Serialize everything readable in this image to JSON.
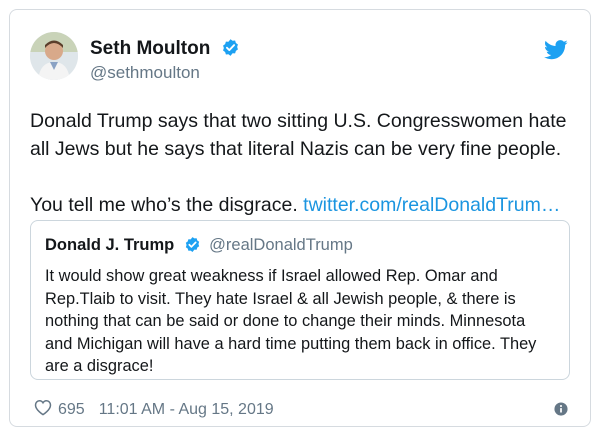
{
  "author": {
    "name": "Seth Moulton",
    "handle": "@sethmoulton"
  },
  "tweet": {
    "lines": [
      "Donald Trump says that two sitting U.S. Congresswomen hate",
      "all Jews but he says that literal Nazis can be very fine people."
    ],
    "closing": "You tell me who’s the disgrace.",
    "link": "twitter.com/realDonaldTrum…"
  },
  "quoted": {
    "name": "Donald J. Trump",
    "handle": "@realDonaldTrump",
    "lines": [
      "It would show great weakness if Israel allowed Rep. Omar and",
      "Rep.Tlaib to visit. They hate Israel & all Jewish people, & there is",
      "nothing that can be said or done to change their minds. Minnesota",
      "and Michigan will have a hard time putting them back in office. They",
      "are a disgrace!"
    ]
  },
  "footer": {
    "likes": "695",
    "timestamp": "11:01 AM - Aug 15, 2019"
  },
  "colors": {
    "twitter_blue": "#1da1f2",
    "link": "#1b95e0",
    "muted": "#657786"
  },
  "icons": {
    "verified": "verified-badge-icon",
    "brand": "twitter-bird-icon",
    "like": "heart-icon",
    "info": "info-icon"
  }
}
